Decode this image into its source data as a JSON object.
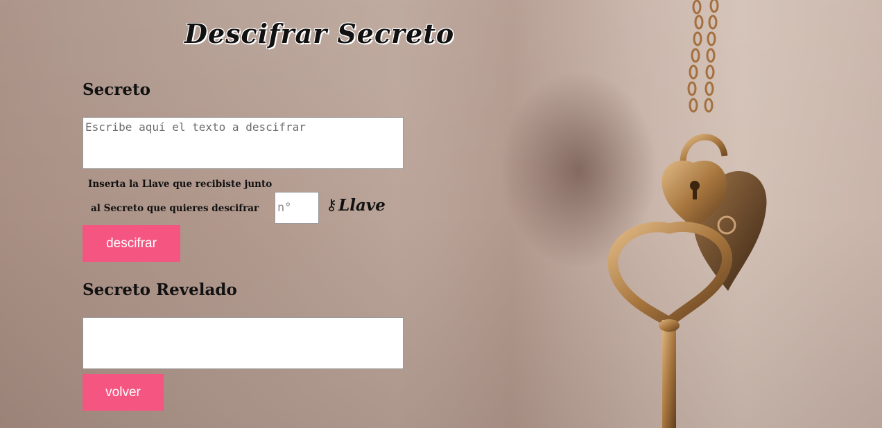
{
  "header": {
    "title": "Descifrar Secreto"
  },
  "secret": {
    "heading": "Secreto",
    "placeholder": "Escribe aquí el texto a descifrar",
    "value": ""
  },
  "key": {
    "label_line1": "Inserta la Llave que recibiste junto",
    "label_line2": "al Secreto que quieres descifrar",
    "placeholder": "n°",
    "value": "",
    "tag_icon": "key-icon",
    "tag_label": "Llave"
  },
  "actions": {
    "decrypt_label": "descifrar",
    "back_label": "volver"
  },
  "revealed": {
    "heading": "Secreto Revelado",
    "value": ""
  },
  "colors": {
    "button": "#f45681",
    "button_text": "#ffffff",
    "text": "#111111"
  }
}
